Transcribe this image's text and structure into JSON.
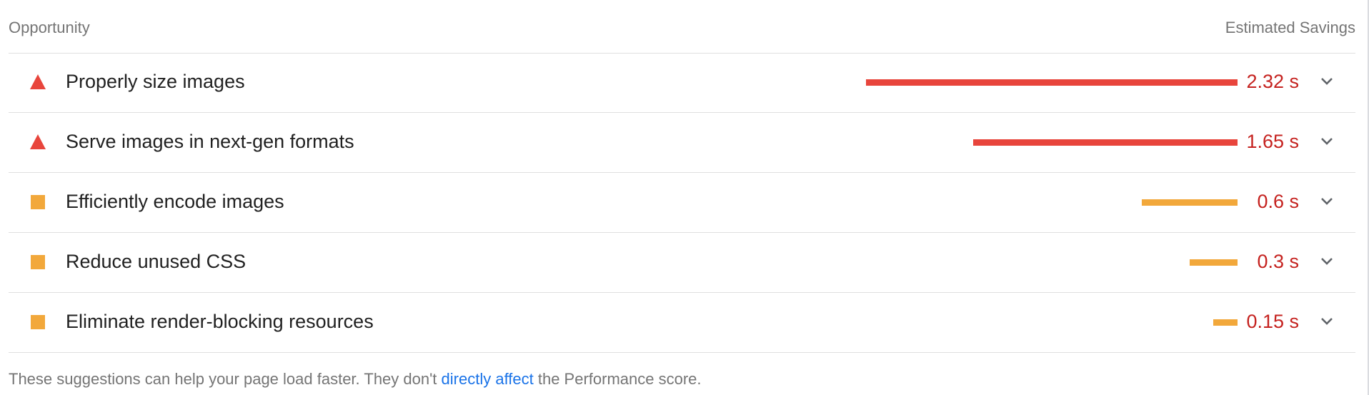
{
  "header": {
    "opportunity_label": "Opportunity",
    "savings_label": "Estimated Savings"
  },
  "opportunities": [
    {
      "title": "Properly size images",
      "savings": "2.32 s",
      "savings_value": 2.32,
      "severity": "fail",
      "icon": "triangle-icon"
    },
    {
      "title": "Serve images in next-gen formats",
      "savings": "1.65 s",
      "savings_value": 1.65,
      "severity": "fail",
      "icon": "triangle-icon"
    },
    {
      "title": "Efficiently encode images",
      "savings": "0.6 s",
      "savings_value": 0.6,
      "severity": "average",
      "icon": "square-icon"
    },
    {
      "title": "Reduce unused CSS",
      "savings": "0.3 s",
      "savings_value": 0.3,
      "severity": "average",
      "icon": "square-icon"
    },
    {
      "title": "Eliminate render-blocking resources",
      "savings": "0.15 s",
      "savings_value": 0.15,
      "severity": "average",
      "icon": "square-icon"
    }
  ],
  "colors": {
    "fail": "#e8453c",
    "average": "#f2a83b",
    "savings_text": "#c5221f",
    "link": "#1a73e8",
    "chevron": "#5f6368"
  },
  "footer": {
    "text_before": "These suggestions can help your page load faster. They don't ",
    "link_text": "directly affect",
    "text_after": " the Performance score."
  }
}
